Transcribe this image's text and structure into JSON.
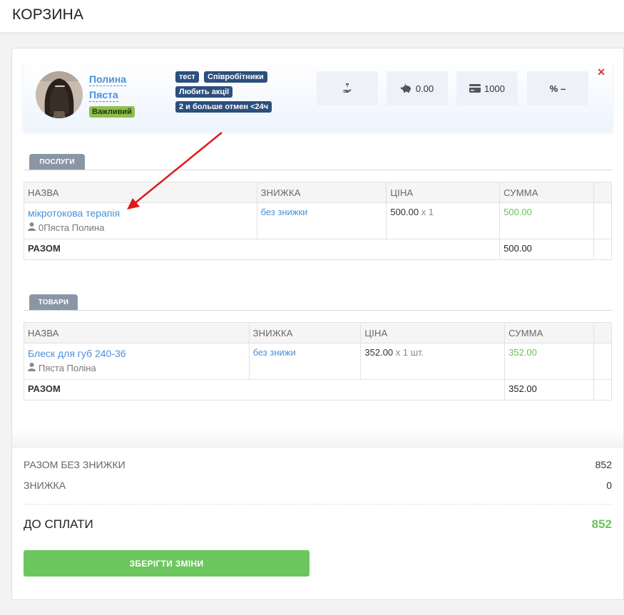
{
  "page": {
    "title": "КОРЗИНА"
  },
  "client": {
    "first_name": "Полина",
    "last_name": "Пяста",
    "status_tag": "Важливий",
    "tags": [
      "тест",
      "Співробітники",
      "Любить акції",
      "2 и больше отмен <24ч"
    ],
    "stats": {
      "bonus_balance": "0.00",
      "card_balance": "1000",
      "discount": "%  –"
    }
  },
  "services": {
    "section_label": "ПОСЛУГИ",
    "columns": [
      "НАЗВА",
      "ЗНИЖКА",
      "ЦІНА",
      "СУММА"
    ],
    "rows": [
      {
        "name": "мікротокова терапія",
        "employee": "0Пяста Полина",
        "discount": "без знижки",
        "price": "500.00",
        "qty": "x 1",
        "sum": "500.00"
      }
    ],
    "total_label": "РАЗОМ",
    "total_value": "500.00"
  },
  "products": {
    "section_label": "ТОВАРИ",
    "columns": [
      "НАЗВА",
      "ЗНИЖКА",
      "ЦІНА",
      "СУММА"
    ],
    "rows": [
      {
        "name": "Блеск для губ 240-36",
        "employee": "Пяста Поліна",
        "discount": "без знижи",
        "price": "352.00",
        "qty": "x 1 шт.",
        "sum": "352.00"
      }
    ],
    "total_label": "РАЗОМ",
    "total_value": "352.00"
  },
  "summary": {
    "subtotal_label": "РАЗОМ БЕЗ ЗНИЖКИ",
    "subtotal_value": "852",
    "discount_label": "ЗНИЖКА",
    "discount_value": "0",
    "to_pay_label": "ДО СПЛАТИ",
    "to_pay_value": "852",
    "save_button": "ЗБЕРІГТИ ЗМІНИ"
  },
  "colors": {
    "accent": "#4a90d9",
    "success": "#6cc65e",
    "tag": "#2c4f7c",
    "important": "#8fbf4d",
    "close": "#e23030",
    "annotation_arrow": "#e0191b"
  }
}
